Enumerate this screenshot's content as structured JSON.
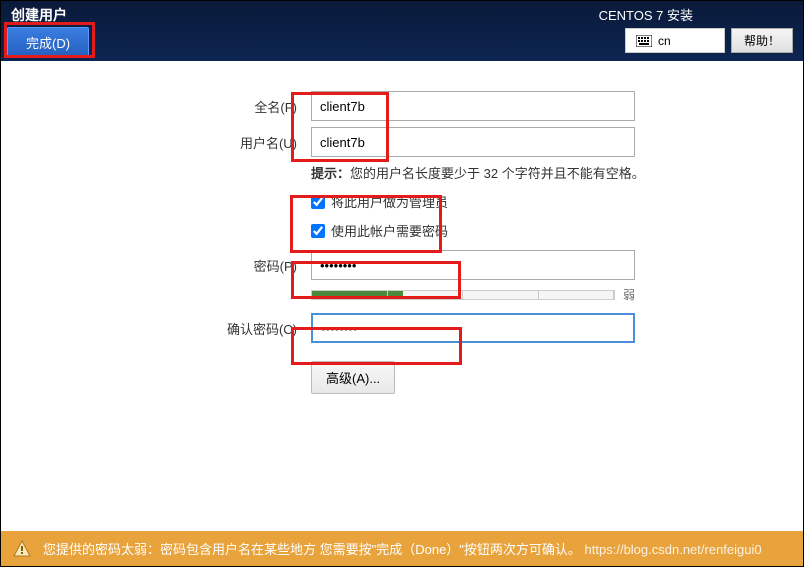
{
  "header": {
    "page_title": "创建用户",
    "done_btn": "完成(D)",
    "installer": "CENTOS 7 安装",
    "lang": "cn",
    "help_btn": "帮助！"
  },
  "form": {
    "fullname_label": "全名(F)",
    "fullname_value": "client7b",
    "username_label": "用户名(U)",
    "username_value": "client7b",
    "hint_prefix": "提示：",
    "hint_text": "您的用户名长度要少于 32 个字符并且不能有空格。",
    "admin_cb": "将此用户做为管理员",
    "reqpw_cb": "使用此帐户需要密码",
    "password_label": "密码(P)",
    "password_value": "••••••••",
    "confirm_label": "确认密码(C)",
    "confirm_value": "••••••••",
    "strength_word": "弱",
    "advanced_btn": "高级(A)..."
  },
  "footer": {
    "warning": "您提供的密码太弱：密码包含用户名在某些地方 您需要按\"完成（Done）\"按钮两次方可确认。",
    "watermark": "https://blog.csdn.net/renfeigui0"
  }
}
